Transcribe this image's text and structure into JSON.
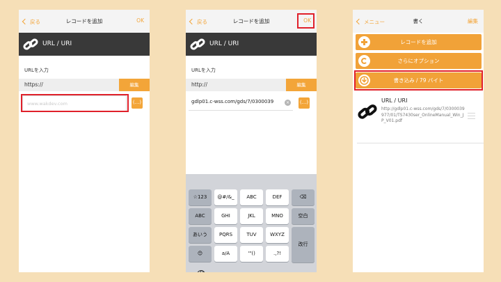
{
  "screen1": {
    "nav": {
      "back": "戻る",
      "title": "レコードを追加",
      "right": "OK"
    },
    "header": {
      "icon": "link-icon",
      "title": "URL / URI"
    },
    "section_label": "URLを入力",
    "scheme": {
      "value": "https://",
      "edit": "編集"
    },
    "url_input": {
      "placeholder": "www.wakdev.com",
      "value": ""
    },
    "more_button": "(...)"
  },
  "screen2": {
    "nav": {
      "back": "戻る",
      "title": "レコードを追加",
      "right": "OK"
    },
    "header": {
      "icon": "link-icon",
      "title": "URL / URI"
    },
    "section_label": "URLを入力",
    "scheme": {
      "value": "http://",
      "edit": "編集"
    },
    "url_input": {
      "value": "gdlp01.c-wss.com/gds/7/0300039"
    },
    "more_button": "(...)",
    "keyboard": {
      "row1": [
        "☆123",
        "@#/&_",
        "ABC",
        "DEF",
        "⌫"
      ],
      "row2": [
        "ABC",
        "GHI",
        "JKL",
        "MNO",
        "空白"
      ],
      "row3": [
        "あいう",
        "PQRS",
        "TUV",
        "WXYZ",
        "改行"
      ],
      "row4": [
        "😊",
        "a/A",
        "'\"()",
        ".,?!"
      ],
      "globe_icon": "globe-icon"
    }
  },
  "screen3": {
    "nav": {
      "back": "メニュー",
      "title": "書く",
      "right": "編集"
    },
    "buttons": [
      {
        "label": "レコードを追加",
        "icon": "plus-icon"
      },
      {
        "label": "さらにオプション",
        "icon": "wrench-icon"
      },
      {
        "label": "書き込み / 79 バイト",
        "icon": "download-icon"
      }
    ],
    "record": {
      "icon": "link-icon",
      "title": "URL / URI",
      "url": "http://gdlp01.c-wss.com/gds/7/0300039977/01/TS7430ser_OnlineManual_Win_JP_V01.pdf"
    }
  },
  "colors": {
    "accent": "#f3a539",
    "highlight": "#e0202a",
    "dark_header": "#393939",
    "background": "#f6dfb7"
  }
}
